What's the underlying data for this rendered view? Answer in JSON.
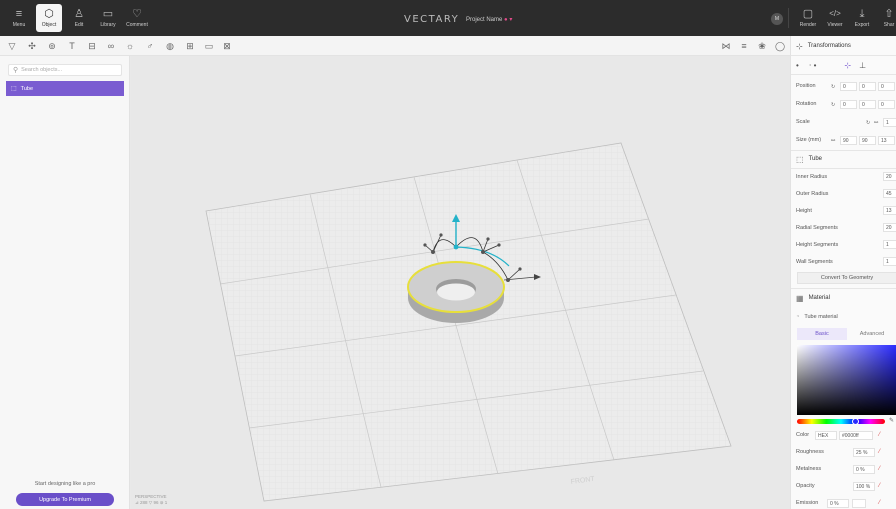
{
  "topbar": {
    "buttons": [
      {
        "label": "Menu",
        "icon": "≡"
      },
      {
        "label": "Object",
        "icon": "⬡"
      },
      {
        "label": "Edit",
        "icon": "♙"
      },
      {
        "label": "Library",
        "icon": "▭"
      },
      {
        "label": "Comment",
        "icon": "♡"
      }
    ],
    "logo": "VECTARY",
    "project_name": "Project Name",
    "project_suffix": "● ▾",
    "avatar": "M",
    "right_buttons": [
      {
        "label": "Render",
        "icon": "▢"
      },
      {
        "label": "Viewer",
        "icon": "</>"
      },
      {
        "label": "Export",
        "icon": "⤓"
      },
      {
        "label": "Shar",
        "icon": "⇧"
      }
    ]
  },
  "toolbar": {
    "tools": [
      "▽",
      "✣",
      "⊚",
      "T",
      "⊟",
      "∞",
      "☼",
      "♂",
      "◍",
      "⊞",
      "▭",
      "⊠"
    ],
    "view_tools": [
      "⋈",
      "≡",
      "❀",
      "◯"
    ]
  },
  "left_panel": {
    "search_placeholder": "Search objects...",
    "objects": [
      {
        "name": "Tube"
      }
    ],
    "promo_text": "Start designing like a pro",
    "upgrade_label": "Upgrade To Premium"
  },
  "viewport": {
    "camera_label": "PERSPECTIVE",
    "stats": "⊿ 288   ▽ 96   ⊚ 1",
    "grid_labels": [
      "FRONT"
    ]
  },
  "right_panel": {
    "transform_title": "Transformations",
    "position_label": "Position",
    "position_values": [
      "0",
      "0",
      "0"
    ],
    "rotation_label": "Rotation",
    "rotation_values": [
      "0",
      "0",
      "0"
    ],
    "scale_label": "Scale",
    "scale_value": "1",
    "size_label": "Size (mm)",
    "size_values": [
      "90",
      "90",
      "13"
    ],
    "object_title": "Tube",
    "params": [
      {
        "label": "Inner Radius",
        "value": "20"
      },
      {
        "label": "Outer Radius",
        "value": "45"
      },
      {
        "label": "Height",
        "value": "13"
      },
      {
        "label": "Radial Segments",
        "value": "20"
      },
      {
        "label": "Height Segments",
        "value": "1"
      },
      {
        "label": "Wall Segments",
        "value": "1"
      }
    ],
    "convert_label": "Convert To Geometry",
    "material_title": "Material",
    "material_name": "Tube material",
    "tab_basic": "Basic",
    "tab_advanced": "Advanced",
    "color_label": "Color",
    "color_mode": "HEX",
    "color_value": "#0000ff",
    "props": [
      {
        "label": "Roughness",
        "value": "25",
        "unit": "%"
      },
      {
        "label": "Metalness",
        "value": "0",
        "unit": "%"
      },
      {
        "label": "Opacity",
        "value": "100",
        "unit": "%"
      }
    ],
    "emission_label": "Emission",
    "emission_value": "0",
    "emission_unit": "%",
    "normal_map_label": "Normal map",
    "ambient_label": "Ambient occlusion"
  }
}
